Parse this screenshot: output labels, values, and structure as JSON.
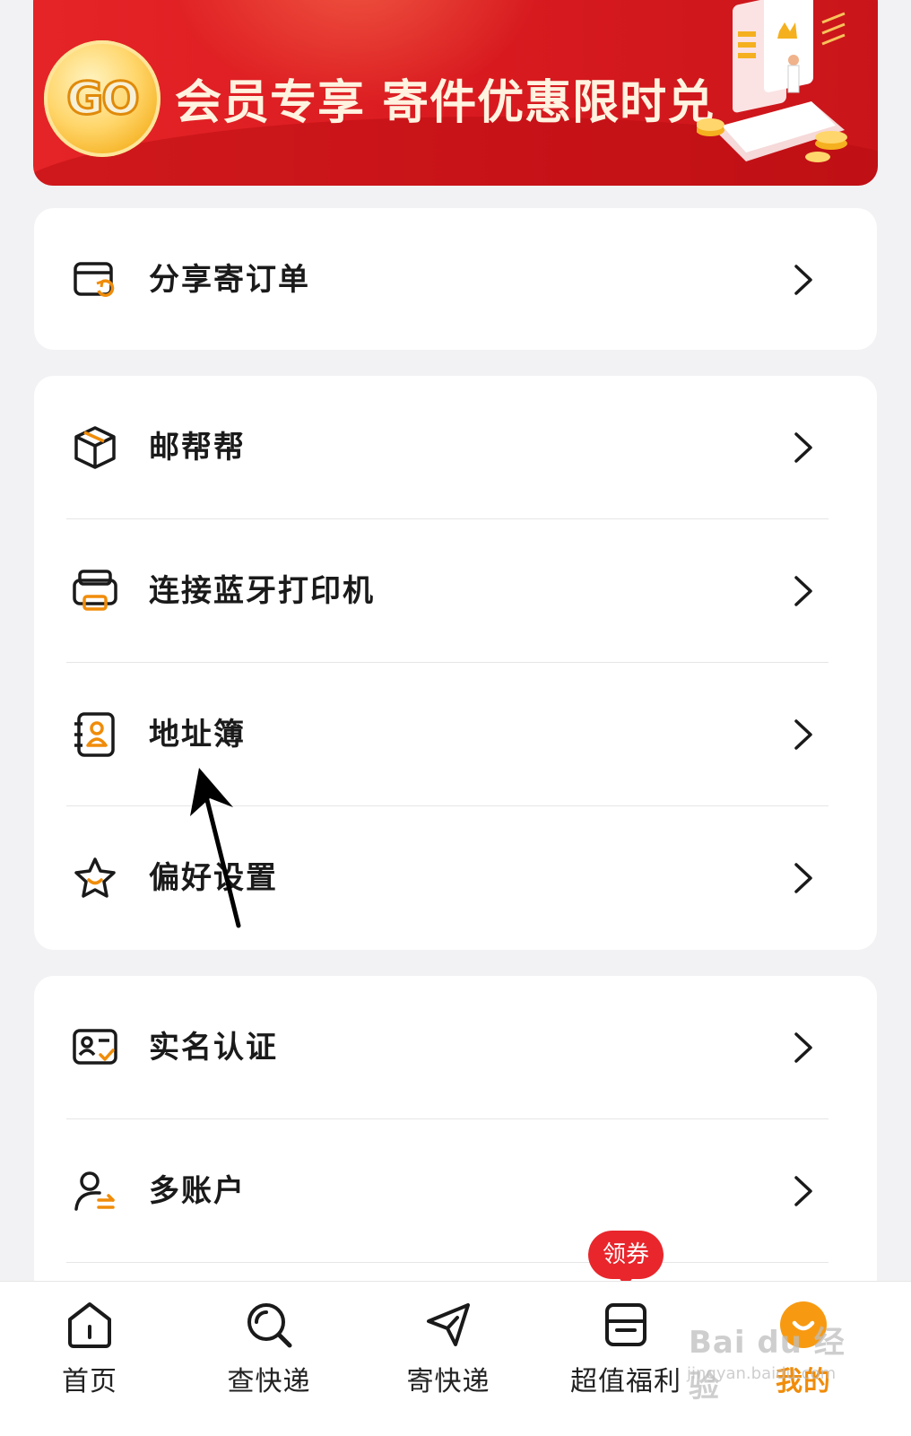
{
  "banner": {
    "go_label": "GO",
    "title": "会员专享 寄件优惠限时兑"
  },
  "groups": [
    {
      "items": [
        {
          "label": "分享寄订单",
          "icon": "share-order-icon"
        }
      ]
    },
    {
      "items": [
        {
          "label": "邮帮帮",
          "icon": "box-icon"
        },
        {
          "label": "连接蓝牙打印机",
          "icon": "printer-icon"
        },
        {
          "label": "地址簿",
          "icon": "address-book-icon"
        },
        {
          "label": "偏好设置",
          "icon": "star-icon"
        }
      ]
    },
    {
      "items": [
        {
          "label": "实名认证",
          "icon": "id-card-icon"
        },
        {
          "label": "多账户",
          "icon": "account-switch-icon"
        }
      ]
    }
  ],
  "tabbar": {
    "tabs": [
      {
        "label": "首页",
        "icon": "home-icon"
      },
      {
        "label": "查快递",
        "icon": "search-icon"
      },
      {
        "label": "寄快递",
        "icon": "send-icon"
      },
      {
        "label": "超值福利",
        "icon": "benefit-icon"
      },
      {
        "label": "我的",
        "icon": "profile-icon"
      }
    ],
    "active_index": 4,
    "coupon_badge": "领券"
  },
  "watermark": {
    "line1": "Bai du 经验",
    "line2": "jingyan.baidu.com"
  },
  "colors": {
    "accent": "#f08c0a",
    "banner_red": "#e52427",
    "background": "#f2f2f4"
  }
}
